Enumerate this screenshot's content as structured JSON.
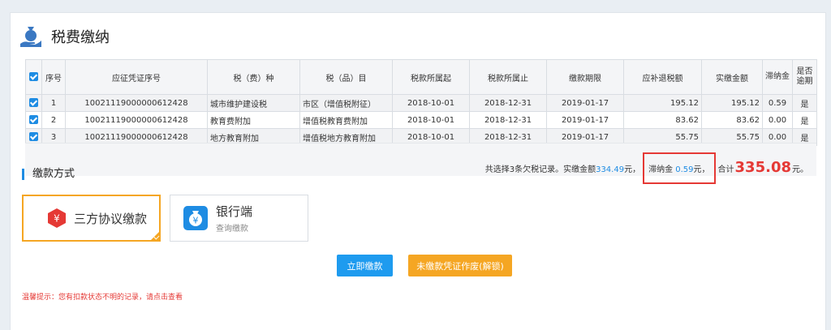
{
  "page": {
    "title": "税费缴纳"
  },
  "table": {
    "headers": {
      "seq": "序号",
      "voucher": "应征凭证序号",
      "tax_type": "税（费）种",
      "tax_item": "税（品）目",
      "period_start": "税款所属起",
      "period_end": "税款所属止",
      "deadline": "缴款期限",
      "due_amount": "应补退税额",
      "actual_amount": "实缴金额",
      "late_fee": "滞纳金",
      "overdue": "是否逾期"
    },
    "rows": [
      {
        "seq": "1",
        "voucher": "10021119000000612428",
        "tax_type": "城市维护建设税",
        "tax_item": "市区（增值税附征）",
        "period_start": "2018-10-01",
        "period_end": "2018-12-31",
        "deadline": "2019-01-17",
        "due_amount": "195.12",
        "actual_amount": "195.12",
        "late_fee": "0.59",
        "overdue": "是"
      },
      {
        "seq": "2",
        "voucher": "10021119000000612428",
        "tax_type": "教育费附加",
        "tax_item": "增值税教育费附加",
        "period_start": "2018-10-01",
        "period_end": "2018-12-31",
        "deadline": "2019-01-17",
        "due_amount": "83.62",
        "actual_amount": "83.62",
        "late_fee": "0.00",
        "overdue": "是"
      },
      {
        "seq": "3",
        "voucher": "10021119000000612428",
        "tax_type": "地方教育附加",
        "tax_item": "增值税地方教育附加",
        "period_start": "2018-10-01",
        "period_end": "2018-12-31",
        "deadline": "2019-01-17",
        "due_amount": "55.75",
        "actual_amount": "55.75",
        "late_fee": "0.00",
        "overdue": "是"
      }
    ]
  },
  "summary": {
    "prefix": "共选择3条欠税记录。实缴金额",
    "actual": "334.49",
    "unit1": "元，",
    "late_label": "滞纳金",
    "late_value": "0.59",
    "unit2": "元，",
    "total_label": "合计",
    "total": "335.08",
    "unit3": "元。"
  },
  "payment": {
    "section_title": "缴款方式",
    "option_tripartite": "三方协议缴款",
    "option_bank_title": "银行端",
    "option_bank_sub": "查询缴款"
  },
  "buttons": {
    "pay_now": "立即缴款",
    "void_voucher": "未缴款凭证作废(解锁)"
  },
  "tip": "温馨提示：您有扣款状态不明的记录，请点击查看",
  "colors": {
    "accent": "#1e8ce3",
    "warn": "#f5a623",
    "alert": "#e53935"
  },
  "icons": {
    "header": "money-bag-hand-icon",
    "tripartite": "yuan-shield-icon",
    "bank": "yuan-bag-icon"
  }
}
